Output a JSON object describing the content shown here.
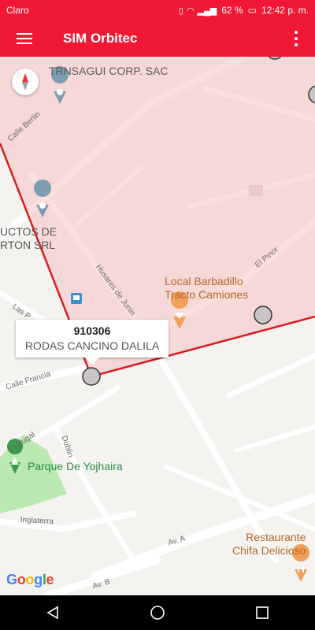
{
  "status_bar": {
    "carrier": "Claro",
    "battery": "62 %",
    "time": "12:42 p. m."
  },
  "app_bar": {
    "title": "SIM Orbitec"
  },
  "map": {
    "streets": [
      "Calle Berlin",
      "Husares de Junin",
      "El Pinor",
      "Las P",
      "Calle Francia",
      "Portugal",
      "Dublin",
      "Inglaterra",
      "Av. A",
      "Av. B"
    ],
    "places": [
      {
        "line1": "TRNSAGUI CORP. SAC",
        "line2": ""
      },
      {
        "line1": "UCTOS DE",
        "line2": "RTON SRL"
      },
      {
        "line1": "Local Barbadillo",
        "line2": "Tracto Camiones"
      },
      {
        "line1": "Parque De Yojhaira",
        "line2": ""
      },
      {
        "line1": "Restaurante",
        "line2": "Chifa Delicioso"
      }
    ],
    "info_window": {
      "id": "910306",
      "name": "RODAS CANCINO DALILA"
    },
    "attribution": "Google",
    "colors": {
      "brand": "#f01834",
      "polygon_fill": "#f9dcdc",
      "polygon_stroke": "#d81e1e",
      "park": "#b9e8b0"
    }
  }
}
